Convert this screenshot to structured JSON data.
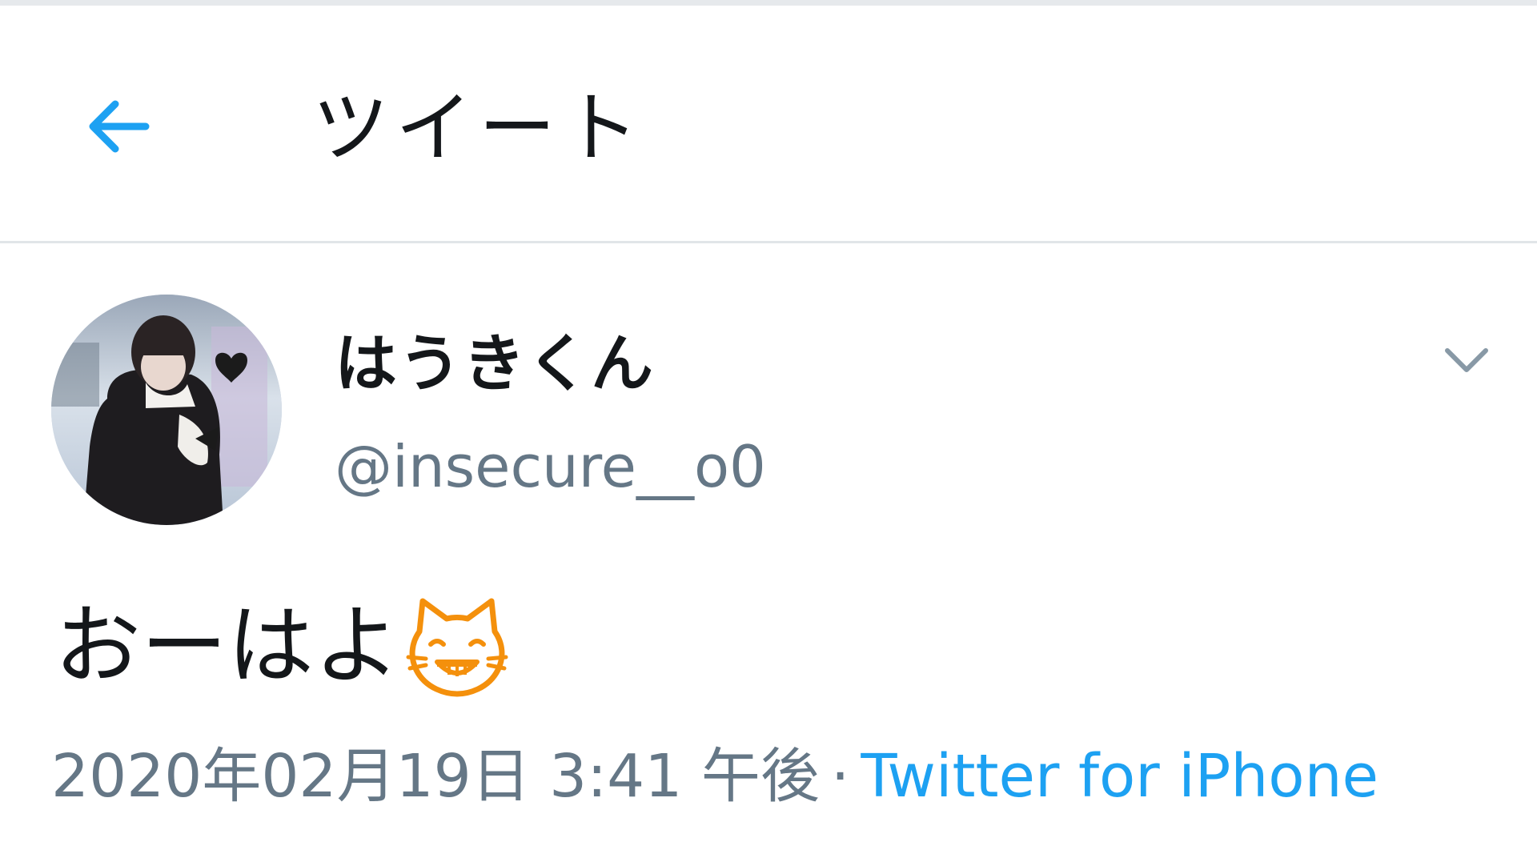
{
  "header": {
    "title": "ツイート",
    "back_icon": "back-arrow-icon"
  },
  "tweet": {
    "author": {
      "display_name": "はうきくん",
      "username": "@insecure__o0",
      "avatar_icon": "avatar-photo"
    },
    "more_icon": "chevron-down-icon",
    "text": "おーはよ",
    "emoji_icon": "grinning-cat-emoji-icon",
    "timestamp": "2020年02月19日 3:41 午後",
    "separator": "·",
    "source": "Twitter for iPhone"
  },
  "colors": {
    "accent": "#1da1f2",
    "text_primary": "#14171a",
    "text_secondary": "#657786",
    "divider": "#e1e5e8",
    "emoji_orange": "#f4900c"
  }
}
